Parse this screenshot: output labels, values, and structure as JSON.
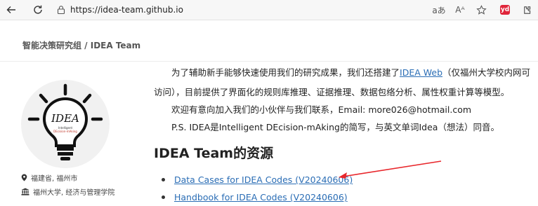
{
  "browser": {
    "url": "https://idea-team.github.io",
    "reader_icon_label": "aあ",
    "text_size_label": "Aᴬ",
    "ext_label": "yd"
  },
  "site": {
    "title": "智能决策研究组 / IDEA Team",
    "location": "福建省, 福州市",
    "affiliation": "福州大学, 经济与管理学院"
  },
  "intro": {
    "line1_prefix": "为了辅助新手能够快速使用我们的研究成果，我们还搭建了",
    "line1_link": "IDEA Web",
    "line1_suffix": "（仅福州大学校内网可",
    "line2": "访问），目前提供了界面化的规则库推理、证据推理、数据包络分析、属性权重计算等模型。",
    "line3": "欢迎有意向加入我们的小伙伴与我们联系，Email: more026@hotmail.com",
    "line4": "P.S. IDEA是Intelligent DEcision-mAking的简写，与英文单词Idea（想法）同音。"
  },
  "resources": {
    "title": "IDEA Team的资源",
    "items": [
      {
        "label": "Data Cases for IDEA Codes (V20240606)"
      },
      {
        "label": "Handbook for IDEA Codes (V20240606)"
      }
    ]
  },
  "logo": {
    "text": "IDEA",
    "sub1": "Intelligent",
    "sub2": "DEcision-mAking"
  },
  "colors": {
    "link": "#2a6db5",
    "annotation_arrow": "#e8262b",
    "ext_badge": "#e0263b"
  }
}
